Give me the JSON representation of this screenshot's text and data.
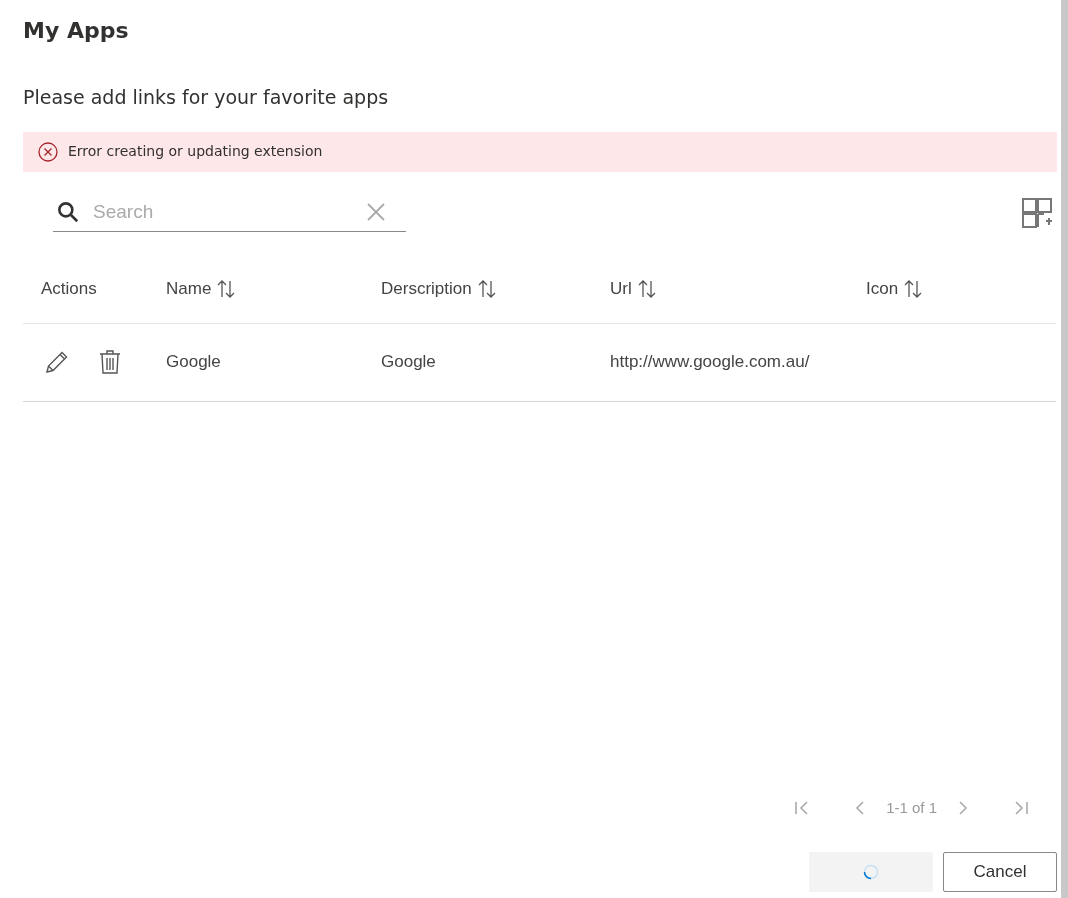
{
  "dialog": {
    "title": "My Apps",
    "subtitle": "Please add links for your favorite apps"
  },
  "error": {
    "message": "Error creating or updating extension"
  },
  "search": {
    "placeholder": "Search"
  },
  "table": {
    "columns": [
      "Actions",
      "Name",
      "Derscription",
      "Url",
      "Icon"
    ],
    "rows": [
      {
        "name": "Google",
        "description": "Google",
        "url": "http://www.google.com.au/"
      }
    ]
  },
  "pagination": {
    "range": "1-1 of 1",
    "first_disabled": true,
    "prev_disabled": true,
    "next_disabled": true,
    "last_disabled": true
  },
  "buttons": {
    "save": {
      "loading": true,
      "disabled": true
    },
    "cancel": "Cancel"
  }
}
